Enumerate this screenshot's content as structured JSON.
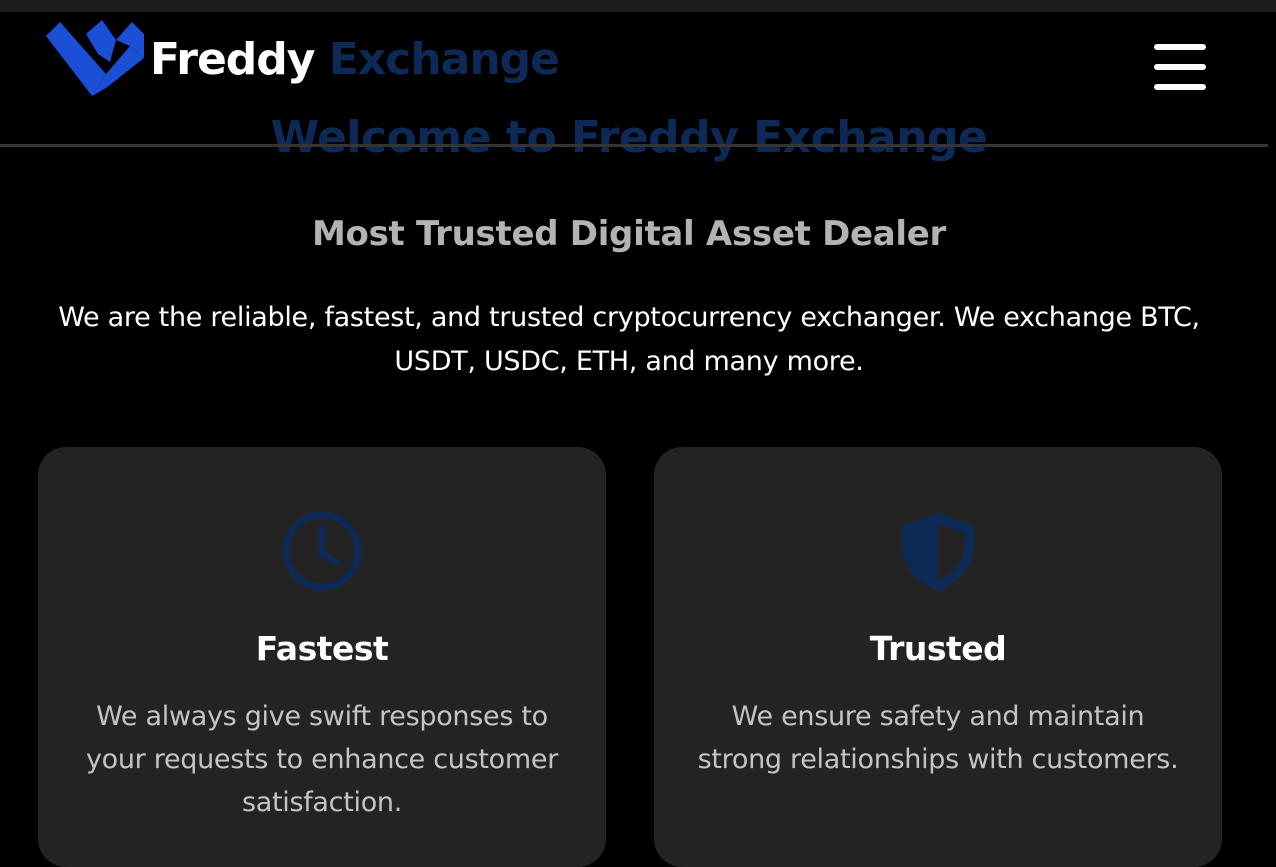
{
  "colors": {
    "background": "#000000",
    "card_background": "#232323",
    "brand_dark_blue": "#0d2a57",
    "brand_blue": "#1a4fd6"
  },
  "header": {
    "logo_word1": "Freddy",
    "logo_word2": "Exchange",
    "menu_icon": "hamburger-menu-icon"
  },
  "hero": {
    "title": "Welcome to Freddy Exchange",
    "subtitle": "Most Trusted Digital Asset Dealer",
    "description": "We are the reliable, fastest, and trusted cryptocurrency exchanger. We exchange BTC, USDT, USDC, ETH, and many more."
  },
  "features": [
    {
      "icon": "clock-icon",
      "title": "Fastest",
      "text": "We always give swift responses to your requests to enhance customer satisfaction."
    },
    {
      "icon": "shield-icon",
      "title": "Trusted",
      "text": "We ensure safety and maintain strong relationships with customers."
    }
  ]
}
